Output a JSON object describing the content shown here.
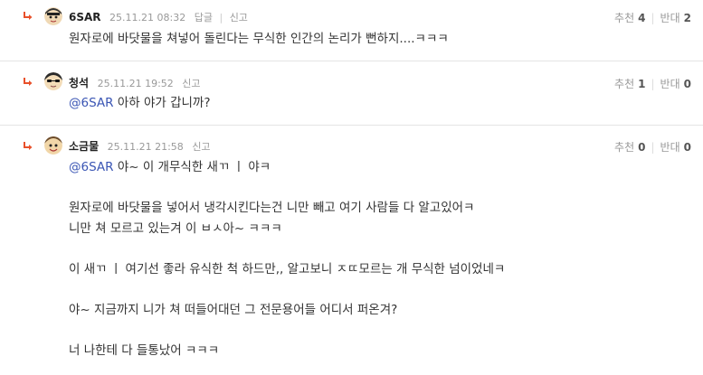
{
  "comments": [
    {
      "nick": "6SAR",
      "date": "25.11.21 08:32",
      "actions": [
        "답글",
        "신고"
      ],
      "recommend_label": "추천",
      "recommend_count": "4",
      "oppose_label": "반대",
      "oppose_count": "2",
      "body": [
        "원자로에 바닷물을 쳐넣어 돌린다는 무식한 인간의 논리가 뻔하지....ㅋㅋㅋ"
      ]
    },
    {
      "nick": "청석",
      "date": "25.11.21 19:52",
      "actions": [
        "신고"
      ],
      "recommend_label": "추천",
      "recommend_count": "1",
      "oppose_label": "반대",
      "oppose_count": "0",
      "mention": "@6SAR",
      "body": [
        " 아하 야가 갑니까?"
      ]
    },
    {
      "nick": "소금물",
      "date": "25.11.21 21:58",
      "actions": [
        "신고"
      ],
      "recommend_label": "추천",
      "recommend_count": "0",
      "oppose_label": "반대",
      "oppose_count": "0",
      "mention": "@6SAR",
      "body": [
        " 야~ 이 개무식한 새ㄲ ㅣ 야ㅋ",
        "",
        "원자로에 바닷물을 넣어서 냉각시킨다는건 니만 빼고 여기 사람들 다 알고있어ㅋ",
        "니만 쳐 모르고 있는겨 이 ㅂㅅ아~ ㅋㅋㅋ",
        "",
        "이 새ㄲ ㅣ  여기선 좋라 유식한 척 하드만,, 알고보니 ㅈㄸ모르는 개 무식한 넘이었네ㅋ",
        "",
        "야~ 지금까지 니가 쳐 떠들어대던 그 전문용어들 어디서 퍼온겨?",
        "",
        "너 나한테 다 들통났어 ㅋㅋㅋ"
      ]
    }
  ],
  "colors": {
    "mention": "#3a55b4",
    "reply_arrow": "#e8502a",
    "divider": "#e4e4e4"
  }
}
